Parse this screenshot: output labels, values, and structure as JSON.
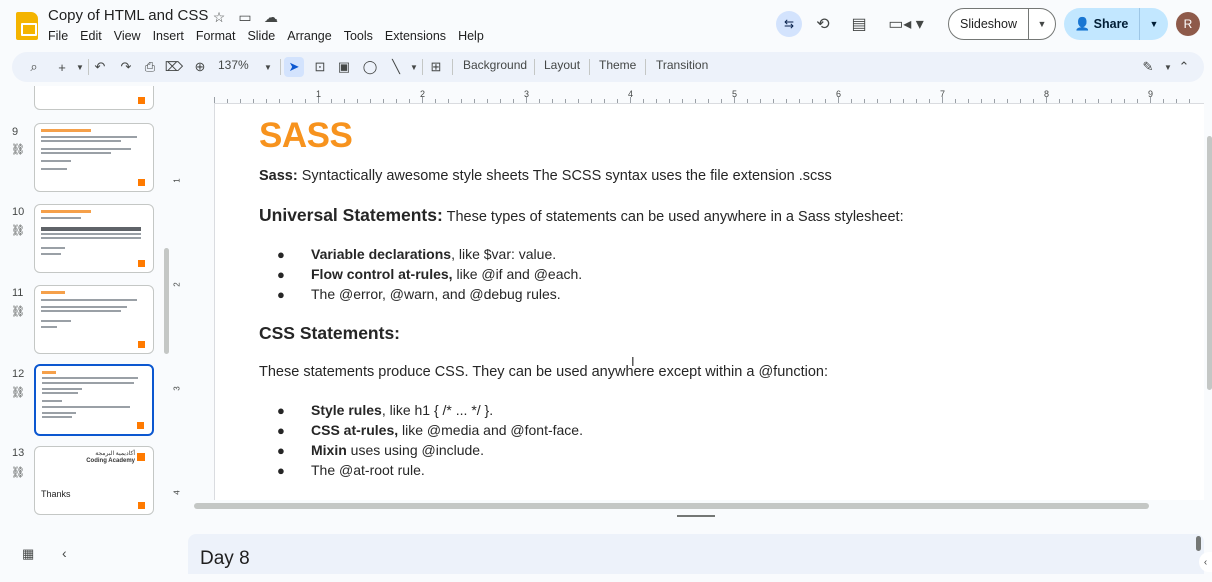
{
  "app": {
    "doc_title": "Copy of HTML and CSS",
    "menu": [
      "File",
      "Edit",
      "View",
      "Insert",
      "Format",
      "Slide",
      "Arrange",
      "Tools",
      "Extensions",
      "Help"
    ],
    "slideshow_label": "Slideshow",
    "share_label": "Share",
    "avatar_initial": "R"
  },
  "toolbar": {
    "zoom": "137%",
    "background_label": "Background",
    "layout_label": "Layout",
    "theme_label": "Theme",
    "transition_label": "Transition"
  },
  "ruler": {
    "h": [
      "1",
      "2",
      "3",
      "4",
      "5",
      "6",
      "7",
      "8",
      "9"
    ],
    "v": [
      "1",
      "2",
      "3",
      "4"
    ]
  },
  "filmstrip": {
    "slides": [
      {
        "number": "9"
      },
      {
        "number": "10"
      },
      {
        "number": "11"
      },
      {
        "number": "12"
      },
      {
        "number": "13",
        "text": "Thanks",
        "arabic": "أكاديمية البرمجة",
        "brand": "Coding Academy"
      }
    ]
  },
  "slide": {
    "title": "SASS",
    "intro_bold": "Sass:",
    "intro_text": " Syntactically awesome style sheets The SCSS syntax uses the file extension .scss",
    "universal_head": "Universal Statements:",
    "universal_rest": " These types of statements can be used anywhere in a Sass stylesheet:",
    "universal_bullets": [
      {
        "bold": "Variable declarations",
        "text": ", like $var: value."
      },
      {
        "bold": "Flow control at-rules,",
        "text": " like @if and @each."
      },
      {
        "bold": "",
        "text": "The @error, @warn, and @debug rules."
      }
    ],
    "css_head": "CSS Statements:",
    "css_intro": "These statements produce CSS. They can be used anywhere except within a @function:",
    "css_bullets": [
      {
        "bold": "Style rules",
        "text": ", like h1 { /* ... */ }."
      },
      {
        "bold": "CSS at-rules,",
        "text": " like @media and @font-face."
      },
      {
        "bold": "Mixin",
        "text": " uses using @include."
      },
      {
        "bold": "",
        "text": "The @at-root rule."
      }
    ]
  },
  "notes": {
    "text": "Day 8"
  },
  "colors": {
    "accent": "#0b57d0",
    "title_orange": "#f7931e",
    "logo_yellow": "#f4b400"
  }
}
